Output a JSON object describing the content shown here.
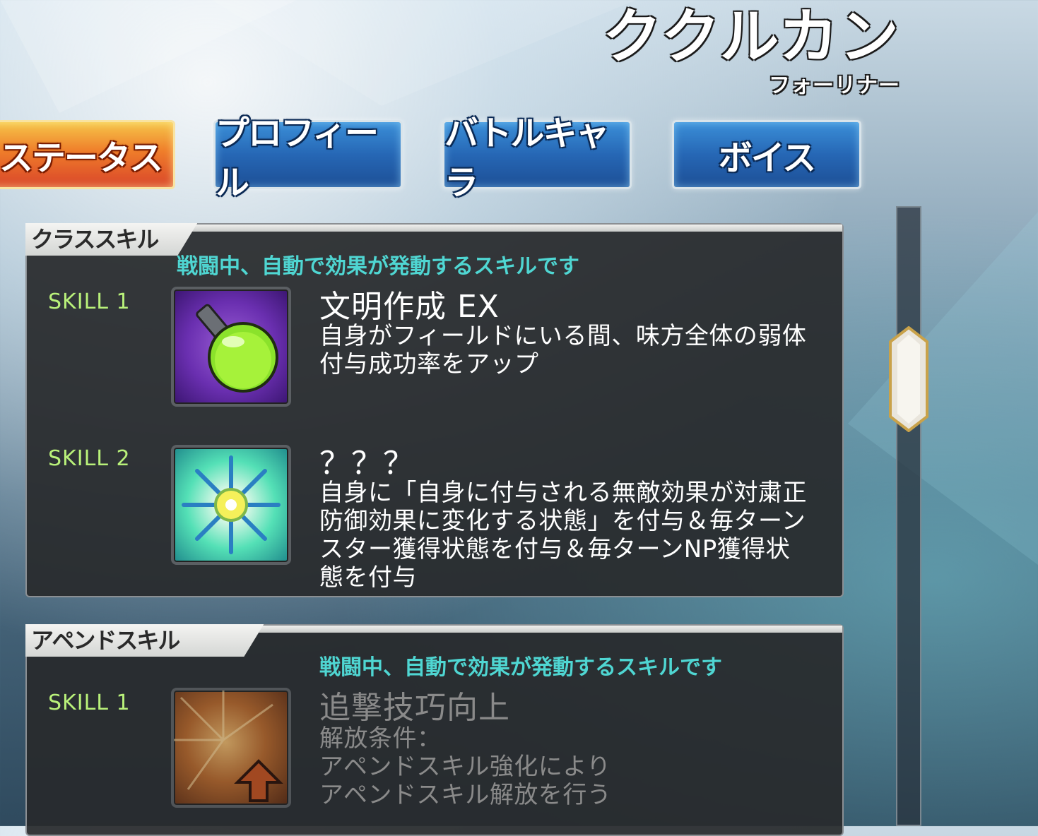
{
  "header": {
    "name": "ククルカン",
    "class": "フォーリナー"
  },
  "tabs": [
    {
      "label": "ステータス",
      "active": true
    },
    {
      "label": "プロフィール",
      "active": false
    },
    {
      "label": "バトルキャラ",
      "active": false
    },
    {
      "label": "ボイス",
      "active": false
    }
  ],
  "class_skills": {
    "title": "クラススキル",
    "description": "戦闘中、自動で効果が発動するスキルです",
    "skills": [
      {
        "label": "SKILL 1",
        "icon": "potion-flask-icon",
        "name": "文明作成 EX",
        "text_lines": [
          "自身がフィールドにいる間、味方全体の弱体",
          "付与成功率をアップ"
        ]
      },
      {
        "label": "SKILL 2",
        "icon": "snowflake-mandala-icon",
        "name": "？？？",
        "text_lines": [
          "自身に「自身に付与される無敵効果が対粛正",
          "防御効果に変化する状態」を付与＆毎ターン",
          "スター獲得状態を付与＆毎ターンNP獲得状",
          "態を付与"
        ]
      }
    ]
  },
  "append_skills": {
    "title": "アペンドスキル",
    "description": "戦闘中、自動で効果が発動するスキルです",
    "skills": [
      {
        "label": "SKILL 1",
        "icon": "burst-up-arrow-icon",
        "name": "追撃技巧向上",
        "text_lines": [
          "解放条件：",
          "アペンドスキル強化により",
          "アペンドスキル解放を行う"
        ]
      }
    ]
  },
  "colors": {
    "accent_cyan": "#4fd6d2",
    "skill_label_green": "#b9f17a",
    "tab_active": "#ef7d2a",
    "tab_inactive": "#2667b5"
  }
}
